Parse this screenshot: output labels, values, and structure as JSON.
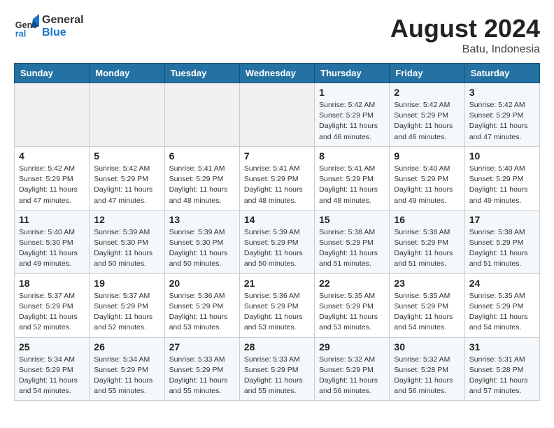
{
  "logo": {
    "general": "General",
    "blue": "Blue"
  },
  "title": "August 2024",
  "location": "Batu, Indonesia",
  "days_of_week": [
    "Sunday",
    "Monday",
    "Tuesday",
    "Wednesday",
    "Thursday",
    "Friday",
    "Saturday"
  ],
  "weeks": [
    [
      {
        "day": "",
        "info": ""
      },
      {
        "day": "",
        "info": ""
      },
      {
        "day": "",
        "info": ""
      },
      {
        "day": "",
        "info": ""
      },
      {
        "day": "1",
        "info": "Sunrise: 5:42 AM\nSunset: 5:29 PM\nDaylight: 11 hours\nand 46 minutes."
      },
      {
        "day": "2",
        "info": "Sunrise: 5:42 AM\nSunset: 5:29 PM\nDaylight: 11 hours\nand 46 minutes."
      },
      {
        "day": "3",
        "info": "Sunrise: 5:42 AM\nSunset: 5:29 PM\nDaylight: 11 hours\nand 47 minutes."
      }
    ],
    [
      {
        "day": "4",
        "info": "Sunrise: 5:42 AM\nSunset: 5:29 PM\nDaylight: 11 hours\nand 47 minutes."
      },
      {
        "day": "5",
        "info": "Sunrise: 5:42 AM\nSunset: 5:29 PM\nDaylight: 11 hours\nand 47 minutes."
      },
      {
        "day": "6",
        "info": "Sunrise: 5:41 AM\nSunset: 5:29 PM\nDaylight: 11 hours\nand 48 minutes."
      },
      {
        "day": "7",
        "info": "Sunrise: 5:41 AM\nSunset: 5:29 PM\nDaylight: 11 hours\nand 48 minutes."
      },
      {
        "day": "8",
        "info": "Sunrise: 5:41 AM\nSunset: 5:29 PM\nDaylight: 11 hours\nand 48 minutes."
      },
      {
        "day": "9",
        "info": "Sunrise: 5:40 AM\nSunset: 5:29 PM\nDaylight: 11 hours\nand 49 minutes."
      },
      {
        "day": "10",
        "info": "Sunrise: 5:40 AM\nSunset: 5:29 PM\nDaylight: 11 hours\nand 49 minutes."
      }
    ],
    [
      {
        "day": "11",
        "info": "Sunrise: 5:40 AM\nSunset: 5:30 PM\nDaylight: 11 hours\nand 49 minutes."
      },
      {
        "day": "12",
        "info": "Sunrise: 5:39 AM\nSunset: 5:30 PM\nDaylight: 11 hours\nand 50 minutes."
      },
      {
        "day": "13",
        "info": "Sunrise: 5:39 AM\nSunset: 5:30 PM\nDaylight: 11 hours\nand 50 minutes."
      },
      {
        "day": "14",
        "info": "Sunrise: 5:39 AM\nSunset: 5:29 PM\nDaylight: 11 hours\nand 50 minutes."
      },
      {
        "day": "15",
        "info": "Sunrise: 5:38 AM\nSunset: 5:29 PM\nDaylight: 11 hours\nand 51 minutes."
      },
      {
        "day": "16",
        "info": "Sunrise: 5:38 AM\nSunset: 5:29 PM\nDaylight: 11 hours\nand 51 minutes."
      },
      {
        "day": "17",
        "info": "Sunrise: 5:38 AM\nSunset: 5:29 PM\nDaylight: 11 hours\nand 51 minutes."
      }
    ],
    [
      {
        "day": "18",
        "info": "Sunrise: 5:37 AM\nSunset: 5:29 PM\nDaylight: 11 hours\nand 52 minutes."
      },
      {
        "day": "19",
        "info": "Sunrise: 5:37 AM\nSunset: 5:29 PM\nDaylight: 11 hours\nand 52 minutes."
      },
      {
        "day": "20",
        "info": "Sunrise: 5:36 AM\nSunset: 5:29 PM\nDaylight: 11 hours\nand 53 minutes."
      },
      {
        "day": "21",
        "info": "Sunrise: 5:36 AM\nSunset: 5:29 PM\nDaylight: 11 hours\nand 53 minutes."
      },
      {
        "day": "22",
        "info": "Sunrise: 5:35 AM\nSunset: 5:29 PM\nDaylight: 11 hours\nand 53 minutes."
      },
      {
        "day": "23",
        "info": "Sunrise: 5:35 AM\nSunset: 5:29 PM\nDaylight: 11 hours\nand 54 minutes."
      },
      {
        "day": "24",
        "info": "Sunrise: 5:35 AM\nSunset: 5:29 PM\nDaylight: 11 hours\nand 54 minutes."
      }
    ],
    [
      {
        "day": "25",
        "info": "Sunrise: 5:34 AM\nSunset: 5:29 PM\nDaylight: 11 hours\nand 54 minutes."
      },
      {
        "day": "26",
        "info": "Sunrise: 5:34 AM\nSunset: 5:29 PM\nDaylight: 11 hours\nand 55 minutes."
      },
      {
        "day": "27",
        "info": "Sunrise: 5:33 AM\nSunset: 5:29 PM\nDaylight: 11 hours\nand 55 minutes."
      },
      {
        "day": "28",
        "info": "Sunrise: 5:33 AM\nSunset: 5:29 PM\nDaylight: 11 hours\nand 55 minutes."
      },
      {
        "day": "29",
        "info": "Sunrise: 5:32 AM\nSunset: 5:29 PM\nDaylight: 11 hours\nand 56 minutes."
      },
      {
        "day": "30",
        "info": "Sunrise: 5:32 AM\nSunset: 5:28 PM\nDaylight: 11 hours\nand 56 minutes."
      },
      {
        "day": "31",
        "info": "Sunrise: 5:31 AM\nSunset: 5:28 PM\nDaylight: 11 hours\nand 57 minutes."
      }
    ]
  ]
}
